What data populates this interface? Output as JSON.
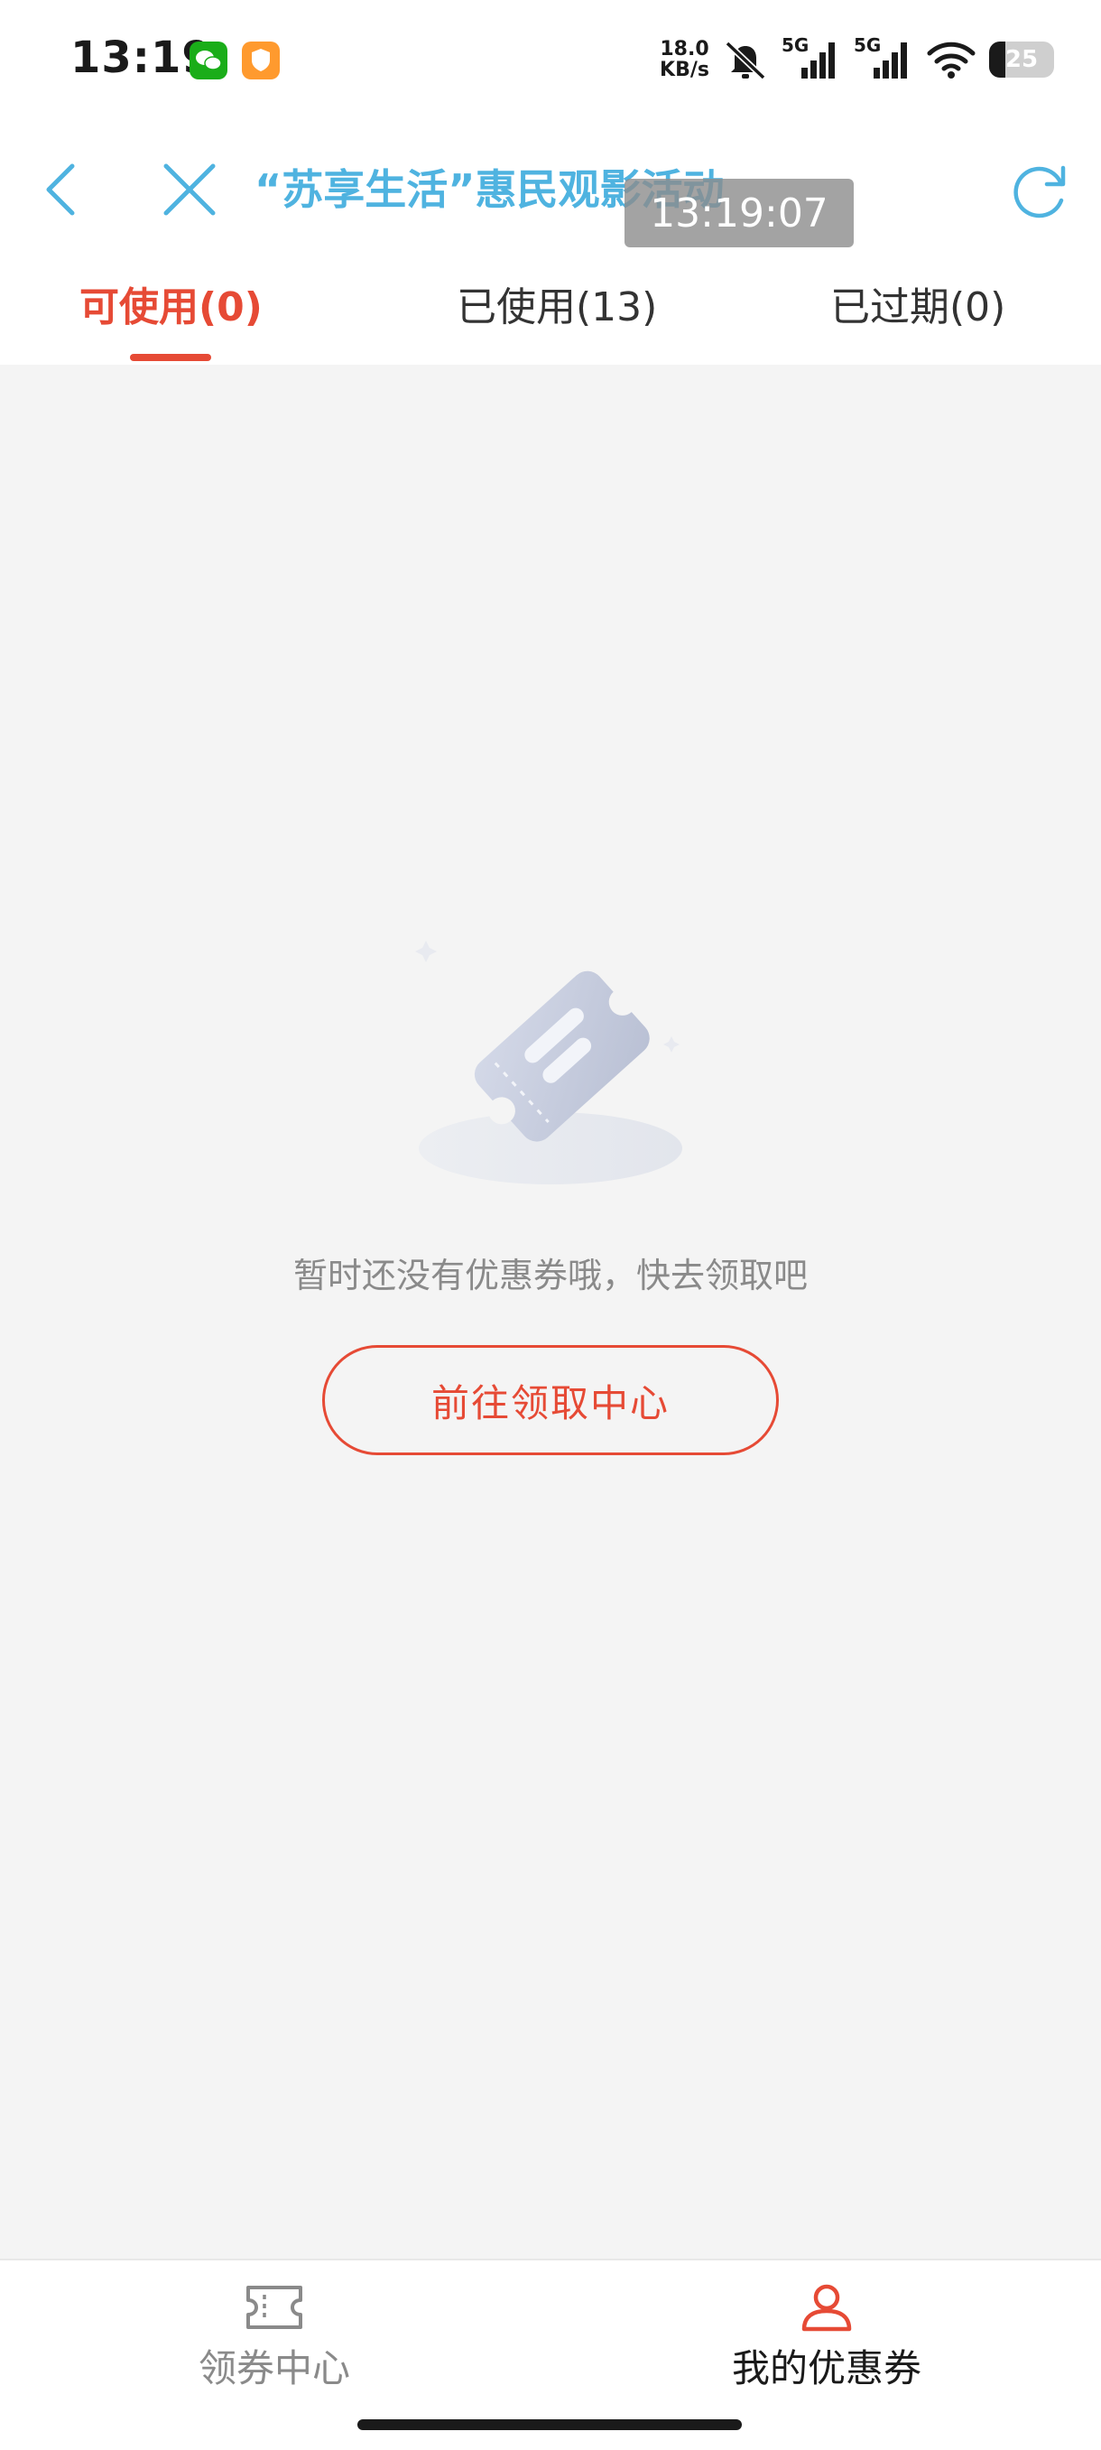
{
  "status_bar": {
    "time": "13:19",
    "net_speed_value": "18.0",
    "net_speed_unit": "KB/s",
    "signal_1_label": "5G",
    "signal_2_label": "5G",
    "battery_level": "25",
    "battery_fraction": 0.25,
    "icons": [
      "wechat-icon",
      "shield-app-icon",
      "mute-icon",
      "signal-icon",
      "wifi-icon",
      "battery-icon"
    ]
  },
  "title_bar": {
    "title": "“苏享生活”惠民观影活动",
    "overlay_time": "13:19:07",
    "icons": [
      "back-icon",
      "close-icon",
      "refresh-icon"
    ]
  },
  "tabs": [
    {
      "label": "可使用(0)",
      "active": true
    },
    {
      "label": "已使用(13)",
      "active": false
    },
    {
      "label": "已过期(0)",
      "active": false
    }
  ],
  "empty_state": {
    "message": "暂时还没有优惠券哦，快去领取吧",
    "button_label": "前往领取中心",
    "icon": "coupon-ticket-icon"
  },
  "bottom_nav": [
    {
      "label": "领券中心",
      "icon": "ticket-icon",
      "active": false
    },
    {
      "label": "我的优惠券",
      "icon": "user-icon",
      "active": true
    }
  ],
  "colors": {
    "accent": "#e64a35",
    "title_blue": "#4fb3e0",
    "background": "#f4f4f4",
    "muted_text": "#8a8a8a"
  }
}
